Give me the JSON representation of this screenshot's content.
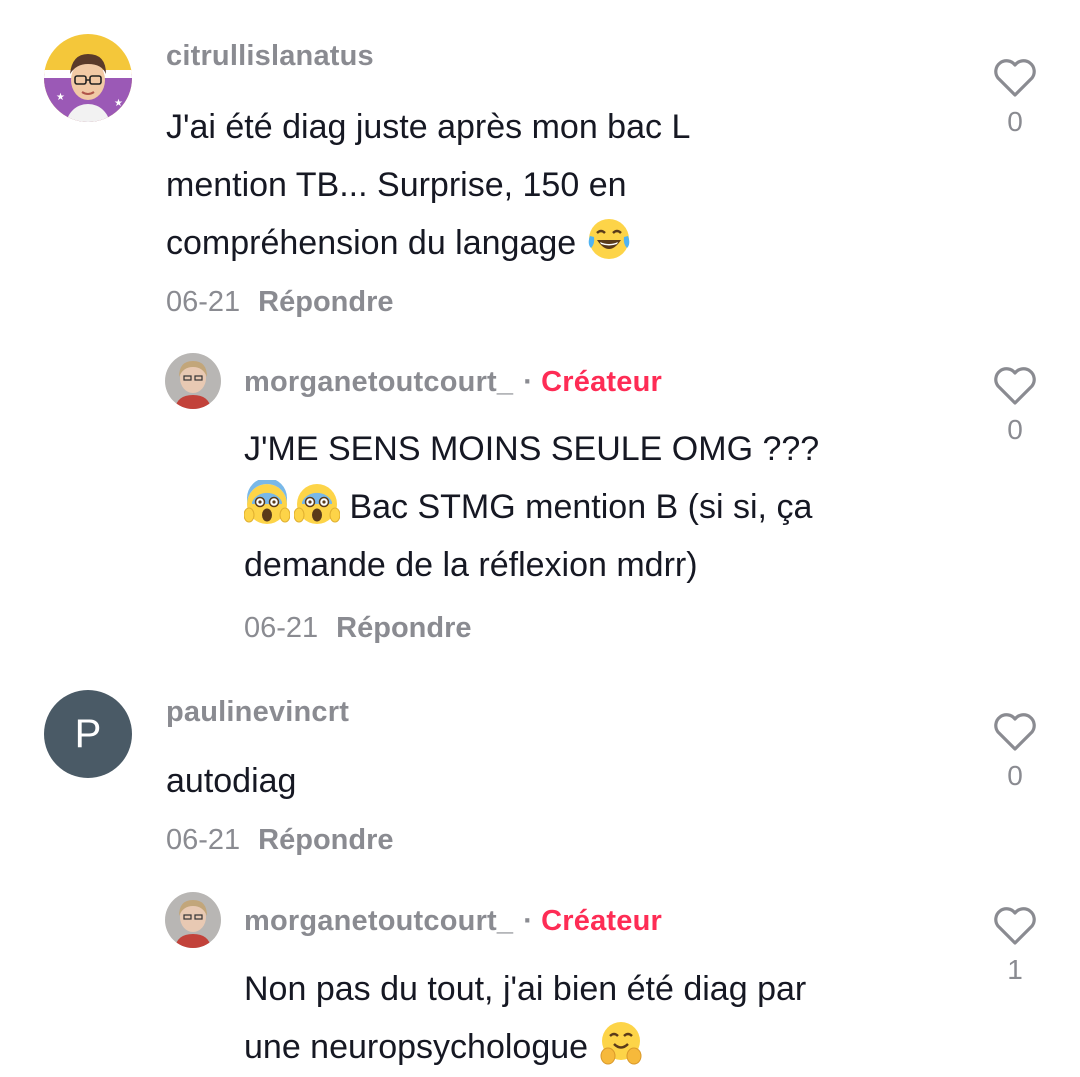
{
  "comments": [
    {
      "username": "citrullislanatus",
      "lines": [
        "J'ai été diag juste après mon bac L",
        "mention TB... Surprise, 150 en",
        "compréhension du langage"
      ],
      "date": "06-21",
      "reply_label": "Répondre",
      "likes": "0",
      "trailing_emoji": "joy-emoji"
    },
    {
      "username": "morganetoutcourt_",
      "separator": "·",
      "badge": "Créateur",
      "lines": [
        "J'ME SENS MOINS SEULE OMG ???",
        "Bac STMG mention B (si si, ça",
        "demande de la réflexion mdrr)"
      ],
      "date": "06-21",
      "reply_label": "Répondre",
      "likes": "0",
      "leading_emoji": "scream-emoji"
    },
    {
      "username": "paulinevincrt",
      "avatar_letter": "P",
      "lines": [
        "autodiag"
      ],
      "date": "06-21",
      "reply_label": "Répondre",
      "likes": "0"
    },
    {
      "username": "morganetoutcourt_",
      "separator": "·",
      "badge": "Créateur",
      "lines": [
        "Non pas du tout, j'ai bien été diag par",
        "une neuropsychologue"
      ],
      "likes": "1",
      "trailing_emoji": "hugging-face-emoji"
    }
  ],
  "colors": {
    "username": "#8a8b91",
    "creator_badge": "#fe2c55",
    "text": "#161823",
    "avatar_letter_bg": "#4a5a66"
  }
}
